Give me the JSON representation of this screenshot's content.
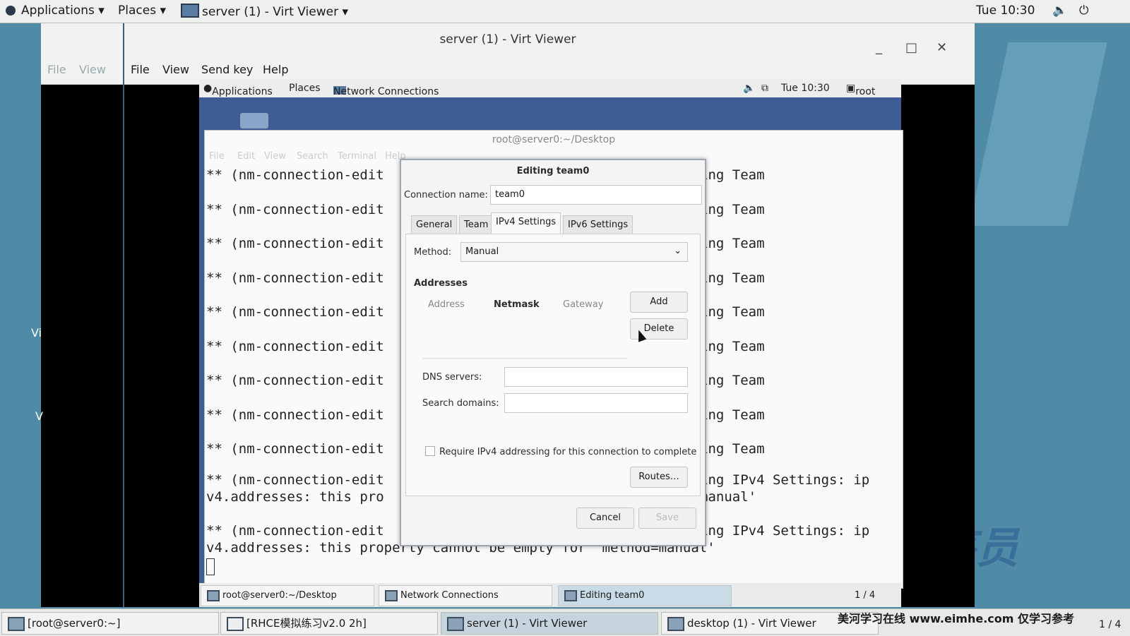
{
  "host_panel": {
    "applications": "Applications",
    "places": "Places",
    "active_window": "server (1) - Virt Viewer",
    "clock": "Tue 10:30"
  },
  "host_window": {
    "title": "server (1) - Virt Viewer",
    "ghost_menu": [
      "File",
      "View"
    ],
    "menu": [
      "File",
      "View",
      "Send key",
      "Help"
    ],
    "side_letters": [
      "Vi",
      "V"
    ]
  },
  "guest_panel": {
    "applications": "Applications",
    "places": "Places",
    "active_window": "Network Connections",
    "clock": "Tue 10:30",
    "user": "root"
  },
  "terminal": {
    "title": "root@server0:~/Desktop",
    "menu": [
      "File",
      "Edit",
      "View",
      "Search",
      "Terminal",
      "Help"
    ],
    "line_head": "** (nm-connection-edit",
    "line_tail": "ing Team",
    "ipv4_head": "** (nm-connection-edit",
    "ipv4_tail": "ing IPv4 Settings: ip",
    "wrap_head": "v4.addresses: this pro",
    "wrap_tail": "manual'",
    "final_line": "v4.addresses: this property cannot be empty for 'method=manual'"
  },
  "dialog": {
    "title": "Editing team0",
    "connection_name_label": "Connection name:",
    "connection_name_value": "team0",
    "tabs": [
      "General",
      "Team",
      "IPv4 Settings",
      "IPv6 Settings"
    ],
    "method_label": "Method:",
    "method_value": "Manual",
    "addresses_heading": "Addresses",
    "columns": [
      "Address",
      "Netmask",
      "Gateway"
    ],
    "add_button": "Add",
    "delete_button": "Delete",
    "dns_label": "DNS servers:",
    "search_label": "Search domains:",
    "require_checkbox": "Require IPv4 addressing for this connection to complete",
    "routes_button": "Routes…",
    "cancel_button": "Cancel",
    "save_button": "Save"
  },
  "guest_taskbar": {
    "items": [
      "root@server0:~/Desktop",
      "Network Connections",
      "Editing team0"
    ],
    "pager": "1 / 4"
  },
  "host_taskbar": {
    "items": [
      "[root@server0:~]",
      "[RHCE模拟练习v2.0 2h]",
      "server (1) - Virt Viewer",
      "desktop (1) - Virt Viewer"
    ],
    "watermark": "美河学习在线 www.eimhe.com 仅学习参考",
    "pager": "1 / 4"
  },
  "colors": {
    "desktop": "#4f8aa6",
    "guest_bg": "#3d5d94",
    "panel": "#eef0ee"
  }
}
